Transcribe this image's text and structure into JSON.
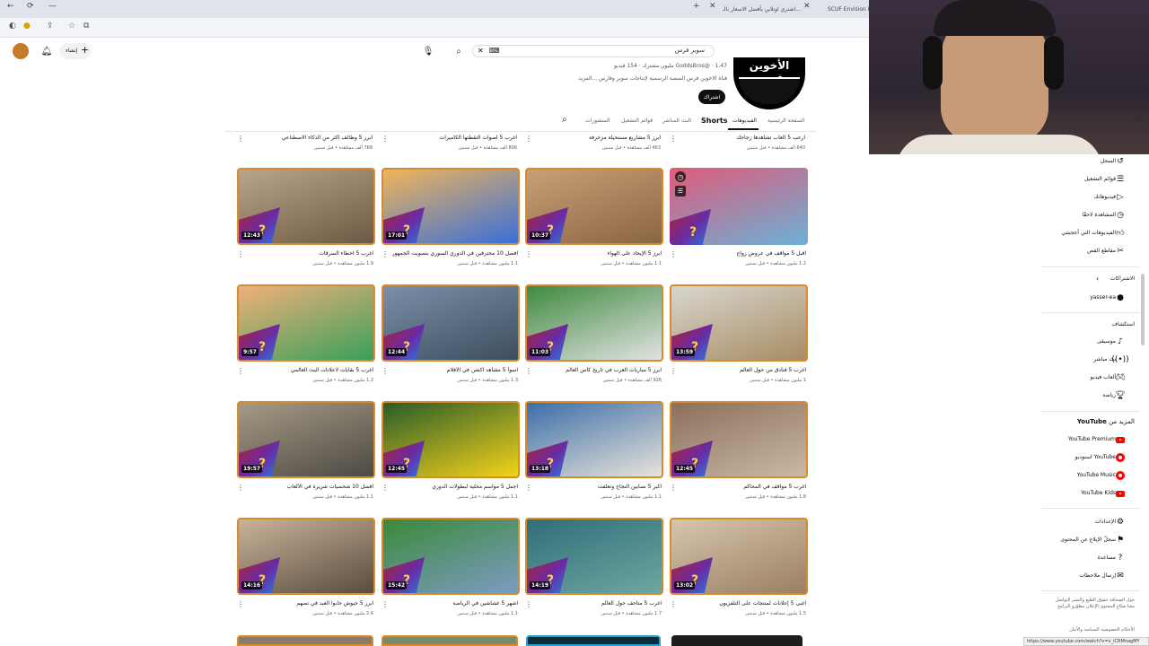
{
  "browser": {
    "tabs": [
      {
        "label": "اشتري اونلاين بأفضل الاسعار بالـ..."
      },
      {
        "label": "SCUF Envision Pr..."
      }
    ],
    "status_url": "https://www.youtube.com/watch?v=v_iCRMnagMY"
  },
  "header": {
    "create_label": "إنشاء",
    "search_value": "سوبر فرس"
  },
  "channel": {
    "name_logo": "الأخوين فرس",
    "handle_line": "GoddsBros@ · 1.47 مليون مشترك · 154 فيديو",
    "description": "قناة الاخوين فرس المنصة الرسمية لإنتاجات سوبر وفارس ...المزيد",
    "subscribe_label": "اشتراك",
    "tabs": [
      "الصفحة الرئيسية",
      "الفيديوهات",
      "Shorts",
      "البث المباشر",
      "قوائم التشغيل",
      "المنشورات"
    ]
  },
  "prev_row": [
    {
      "title": "ارعب 5 العاب تشاهدها زجاجك",
      "meta": "640 ألف مشاهدة • قبل سنتين"
    },
    {
      "title": "ابرز 5 مشاريع مستحيلة مزخرفة",
      "meta": "463 ألف مشاهدة • قبل سنتين"
    },
    {
      "title": "اغرب 5 اصوات التقطتها الكاميرات",
      "meta": "806 ألف مشاهدة • قبل سنتين"
    },
    {
      "title": "ابرز 5 وظائف اكثر من الذكاء الاصطناعي",
      "meta": "768 ألف مشاهدة • قبل سنتين"
    }
  ],
  "videos": [
    {
      "duration": "12:43",
      "title": "اغرب 5 اخطاء السرقات",
      "meta": "1.9 مليون مشاهدة • قبل سنتين"
    },
    {
      "duration": "17:01",
      "title": "افضل 10 محترفين في الدوري السوري بتصويت الجمهور",
      "meta": "1.1 مليون مشاهدة • قبل سنتين"
    },
    {
      "duration": "10:37",
      "title": "ابرز 5 الإيجاد على الهواء",
      "meta": "1.1 مليون مشاهدة • قبل سنتين"
    },
    {
      "duration": "",
      "title": "اقبل 5 مواقف في عروض زواج",
      "meta": "1.2 مليون مشاهدة • قبل سنتين"
    },
    {
      "duration": "9:57",
      "title": "اغرب 5 بقايات لاعلانات البث العالمي",
      "meta": "1.2 مليون مشاهدة • قبل سنتين"
    },
    {
      "duration": "12:44",
      "title": "اسوأ 5 مشاهد اكشن في الافلام",
      "meta": "1.3 مليون مشاهدة • قبل سنتين"
    },
    {
      "duration": "11:03",
      "title": "ابرز 5 مباريات العرب في تاريخ كأس العالم",
      "meta": "926 ألف مشاهدة • قبل سنتين"
    },
    {
      "duration": "13:59",
      "title": "اغرب 5 فنادق من حول العالم",
      "meta": "1 مليون مشاهدة • قبل سنتين"
    },
    {
      "duration": "19:57",
      "title": "افضل 10 شخصيات شريرة في الألعاب",
      "meta": "1.1 مليون مشاهدة • قبل سنتين"
    },
    {
      "duration": "12:45",
      "title": "اجمل 5 مواسم محلية لبطولات الدوري",
      "meta": "1.1 مليون مشاهدة • قبل سنتين"
    },
    {
      "duration": "13:18",
      "title": "اكبر 5 نصابين النجاح وتعلقت",
      "meta": "1.1 مليون مشاهدة • قبل سنتين"
    },
    {
      "duration": "12:45",
      "title": "اغرب 5 مواقف في المحاكم",
      "meta": "1.8 مليون مشاهدة • قبل سنتين"
    },
    {
      "duration": "14:16",
      "title": "ابرز 5 جيوش جابوا العبد في تصهم",
      "meta": "2.6 مليون مشاهدة • قبل سنتين"
    },
    {
      "duration": "15:42",
      "title": "اشهر 5 غشاشين في الرياضة",
      "meta": "1.1 مليون مشاهدة • قبل سنتين"
    },
    {
      "duration": "14:19",
      "title": "اغرب 5 متاحف حول العالم",
      "meta": "1.7 مليون مشاهدة • قبل سنتين"
    },
    {
      "duration": "13:02",
      "title": "اغبى 5 إعلانات لمنتجات على التلفزيون",
      "meta": "1.5 مليون مشاهدة • قبل سنتين"
    }
  ],
  "sidebar": {
    "you_items": [
      "السجل",
      "قوائم التشغيل",
      "فيديوهاتك",
      "المشاهدة لاحقًا",
      "الفيديوهات التي أعجبتني",
      "مقاطع القص"
    ],
    "subs_header": "الاشتراكات",
    "subs": [
      "yasser-ea"
    ],
    "explore_header": "استكشاف",
    "explore": [
      "موسيقى",
      "بث مباشر",
      "ألعاب فيديو",
      "رياضة"
    ],
    "more_header_prefix": "المزيد من",
    "more_header_brand": "YouTube",
    "more": [
      "YouTube Premium",
      "YouTube استوديو",
      "YouTube Music",
      "YouTube Kids"
    ],
    "settings": [
      "الإعدادات",
      "سجلّ الإبلاغ عن المحتوى",
      "مساعدة",
      "إرسال ملاحظات"
    ],
    "footer1": "حول  الصحافة  حقوق الطبع والنشر  التواصل معنا  صنّاع المحتوى  الإعلان  مطوّرو البرامج",
    "footer2": "الأحكام  الخصوصية  السياسة والأمان"
  }
}
